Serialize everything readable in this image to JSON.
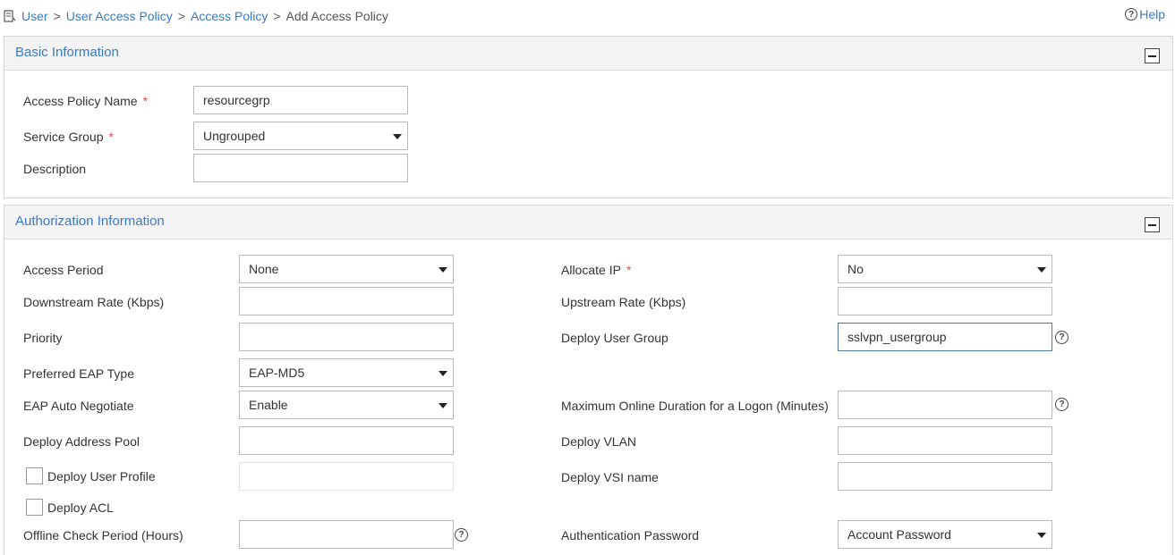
{
  "breadcrumb": {
    "items": [
      "User",
      "User Access Policy",
      "Access Policy"
    ],
    "separator": ">",
    "current": "Add Access Policy"
  },
  "help": {
    "label": "Help",
    "icon": "question-circle-icon"
  },
  "basic": {
    "title": "Basic Information",
    "policy_name": {
      "label": "Access Policy Name",
      "required": "*",
      "value": "resourcegrp"
    },
    "service_group": {
      "label": "Service Group",
      "required": "*",
      "value": "Ungrouped"
    },
    "description": {
      "label": "Description",
      "value": ""
    }
  },
  "auth": {
    "title": "Authorization Information",
    "access_period": {
      "label": "Access Period",
      "value": "None"
    },
    "downstream_rate": {
      "label": "Downstream Rate (Kbps)",
      "value": ""
    },
    "priority": {
      "label": "Priority",
      "value": ""
    },
    "eap_type": {
      "label": "Preferred EAP Type",
      "value": "EAP-MD5"
    },
    "eap_auto": {
      "label": "EAP Auto Negotiate",
      "value": "Enable"
    },
    "address_pool": {
      "label": "Deploy Address Pool",
      "value": ""
    },
    "user_profile": {
      "label": "Deploy User Profile",
      "checked": false,
      "value": ""
    },
    "acl": {
      "label": "Deploy ACL",
      "checked": false
    },
    "offline_check": {
      "label": "Offline Check Period (Hours)",
      "value": ""
    },
    "allocate_ip": {
      "label": "Allocate IP",
      "required": "*",
      "value": "No"
    },
    "upstream_rate": {
      "label": "Upstream Rate (Kbps)",
      "value": ""
    },
    "user_group": {
      "label": "Deploy User Group",
      "value": "sslvpn_usergroup"
    },
    "max_online": {
      "label": "Maximum Online Duration for a Logon (Minutes)",
      "value": ""
    },
    "vlan": {
      "label": "Deploy VLAN",
      "value": ""
    },
    "vsi": {
      "label": "Deploy VSI name",
      "value": ""
    },
    "auth_password": {
      "label": "Authentication Password",
      "value": "Account Password"
    }
  },
  "colors": {
    "link": "#3b7ac0",
    "required": "#d9534f",
    "header_bg": "#f3f3f3"
  }
}
